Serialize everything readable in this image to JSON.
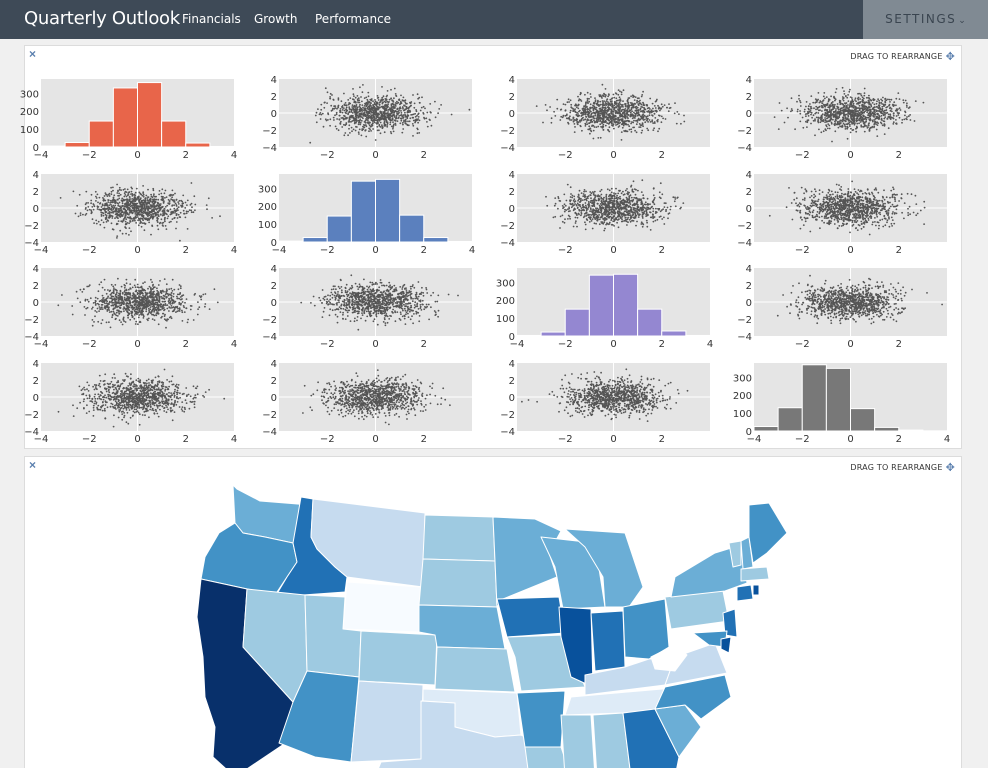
{
  "navbar": {
    "brand": "Quarterly Outlook",
    "links": [
      "Financials",
      "Growth",
      "Performance"
    ],
    "settings_label": "SETTINGS",
    "settings_caret": "⌄"
  },
  "panels": [
    {
      "close_glyph": "×",
      "drag_label": "DRAG TO REARRANGE",
      "drag_icon": "✥"
    },
    {
      "close_glyph": "×",
      "drag_label": "DRAG TO REARRANGE",
      "drag_icon": "✥"
    }
  ],
  "chart_data": [
    {
      "type": "scatter-matrix",
      "rows": 4,
      "cols": 4,
      "diagonal": "histogram",
      "off_diagonal": "scatter",
      "points_per_panel": 1000,
      "scatter_color": "#555555",
      "background": "#e5e5e5",
      "histogram": {
        "bin_edges": [
          -4,
          -3,
          -2,
          -1,
          0,
          1,
          2,
          3,
          4
        ],
        "series": [
          {
            "color": "#e8654a",
            "values": [
              5,
              25,
              145,
              330,
              360,
              145,
              22,
              3
            ]
          },
          {
            "color": "#5b80be",
            "values": [
              5,
              25,
              145,
              340,
              350,
              150,
              25,
              3
            ]
          },
          {
            "color": "#9487d1",
            "values": [
              3,
              22,
              150,
              340,
              345,
              150,
              28,
              3
            ]
          },
          {
            "color": "#787878",
            "values": [
              25,
              130,
              370,
              350,
              125,
              20,
              5,
              1
            ]
          }
        ]
      },
      "x_ticks": [
        "−4",
        "−2",
        "0",
        "2",
        "4"
      ],
      "scatter_y_ticks": [
        "4",
        "2",
        "0",
        "−2",
        "−4"
      ],
      "hist_y_ticks": [
        "300",
        "200",
        "100",
        "0"
      ]
    },
    {
      "type": "choropleth",
      "region": "USA states",
      "colorscale": [
        "#f7fbff",
        "#deebf7",
        "#c6dbef",
        "#9ecae1",
        "#6baed6",
        "#4292c6",
        "#2171b5",
        "#08306b"
      ]
    }
  ]
}
